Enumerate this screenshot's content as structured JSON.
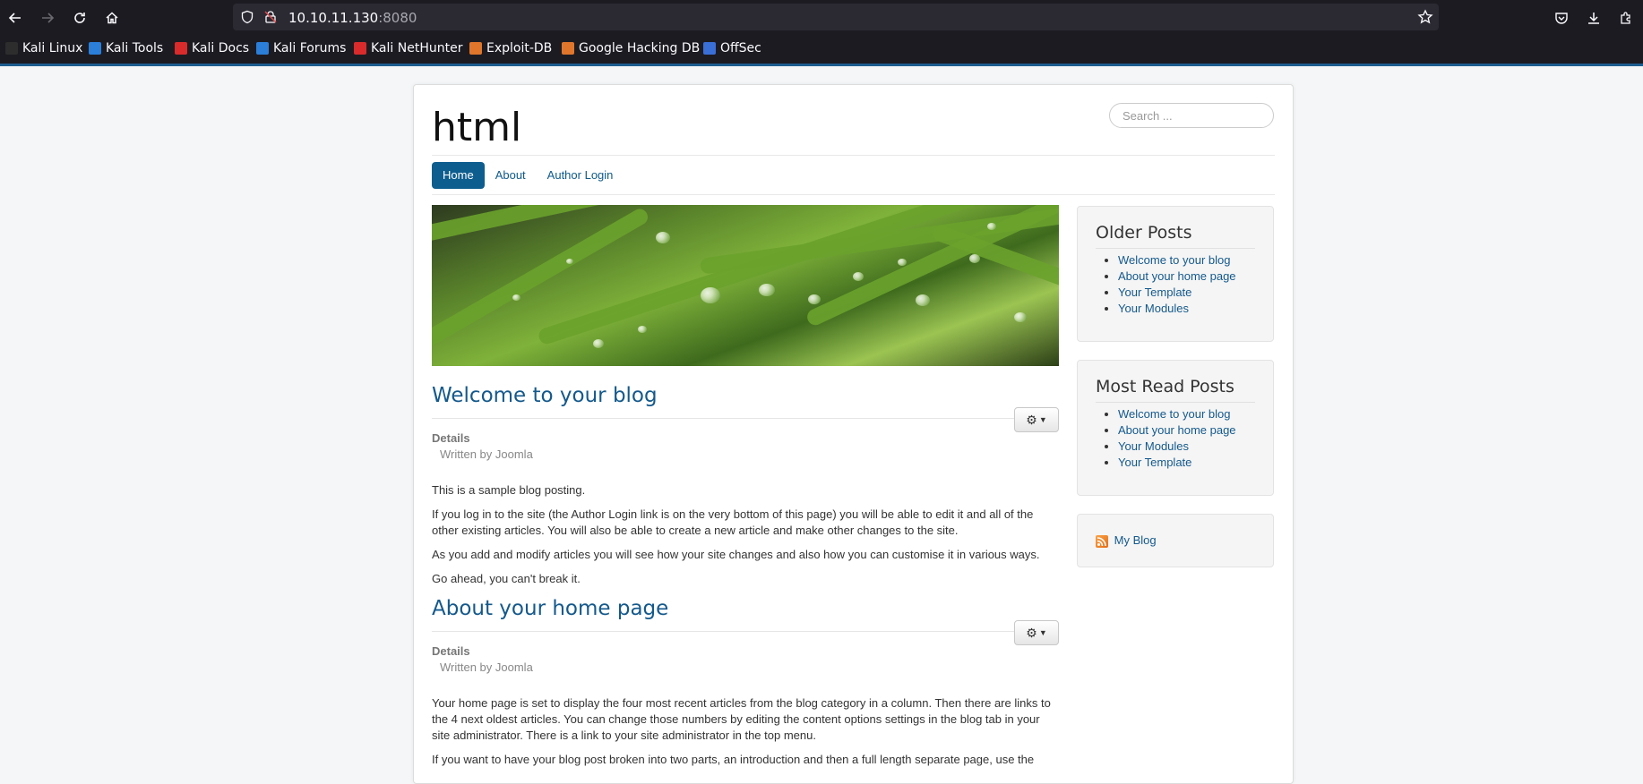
{
  "browser": {
    "url_host": "10.10.11.130",
    "url_port": ":8080",
    "bookmarks": [
      {
        "label": "Kali Linux",
        "color": "#2d2d2d"
      },
      {
        "label": "Kali Tools",
        "color": "#2b7fd9"
      },
      {
        "label": "Kali Docs",
        "color": "#d92b2b"
      },
      {
        "label": "Kali Forums",
        "color": "#2b7fd9"
      },
      {
        "label": "Kali NetHunter",
        "color": "#d92b2b"
      },
      {
        "label": "Exploit-DB",
        "color": "#e0762b"
      },
      {
        "label": "Google Hacking DB",
        "color": "#e0762b"
      },
      {
        "label": "OffSec",
        "color": "#3a6fd8"
      }
    ]
  },
  "site": {
    "title": "html",
    "search_placeholder": "Search ...",
    "menu": [
      {
        "label": "Home",
        "active": true
      },
      {
        "label": "About",
        "active": false
      },
      {
        "label": "Author Login",
        "active": false
      }
    ]
  },
  "posts": [
    {
      "title": "Welcome to your blog",
      "details_label": "Details",
      "written_by": "Written by Joomla",
      "paragraphs": [
        "This is a sample blog posting.",
        "If you log in to the site (the Author Login link is on the very bottom of this page) you will be able to edit it and all of the other existing articles. You will also be able to create a new article and make other changes to the site.",
        "As you add and modify articles you will see how your site changes and also how you can customise it in various ways.",
        "Go ahead, you can't break it."
      ]
    },
    {
      "title": "About your home page",
      "details_label": "Details",
      "written_by": "Written by Joomla",
      "paragraphs": [
        "Your home page is set to display the four most recent articles from the blog category in a column. Then there are links to the 4 next oldest articles. You can change those numbers by editing the content options settings in the blog tab in your site administrator. There is a link to your site administrator in the top menu.",
        "If you want to have your blog post broken into two parts, an introduction and then a full length separate page, use the"
      ]
    }
  ],
  "sidebar": {
    "older_posts": {
      "title": "Older Posts",
      "items": [
        "Welcome to your blog",
        "About your home page",
        "Your Template",
        "Your Modules"
      ]
    },
    "most_read": {
      "title": "Most Read Posts",
      "items": [
        "Welcome to your blog",
        "About your home page",
        "Your Modules",
        "Your Template"
      ]
    },
    "feed": {
      "label": "My Blog"
    }
  }
}
